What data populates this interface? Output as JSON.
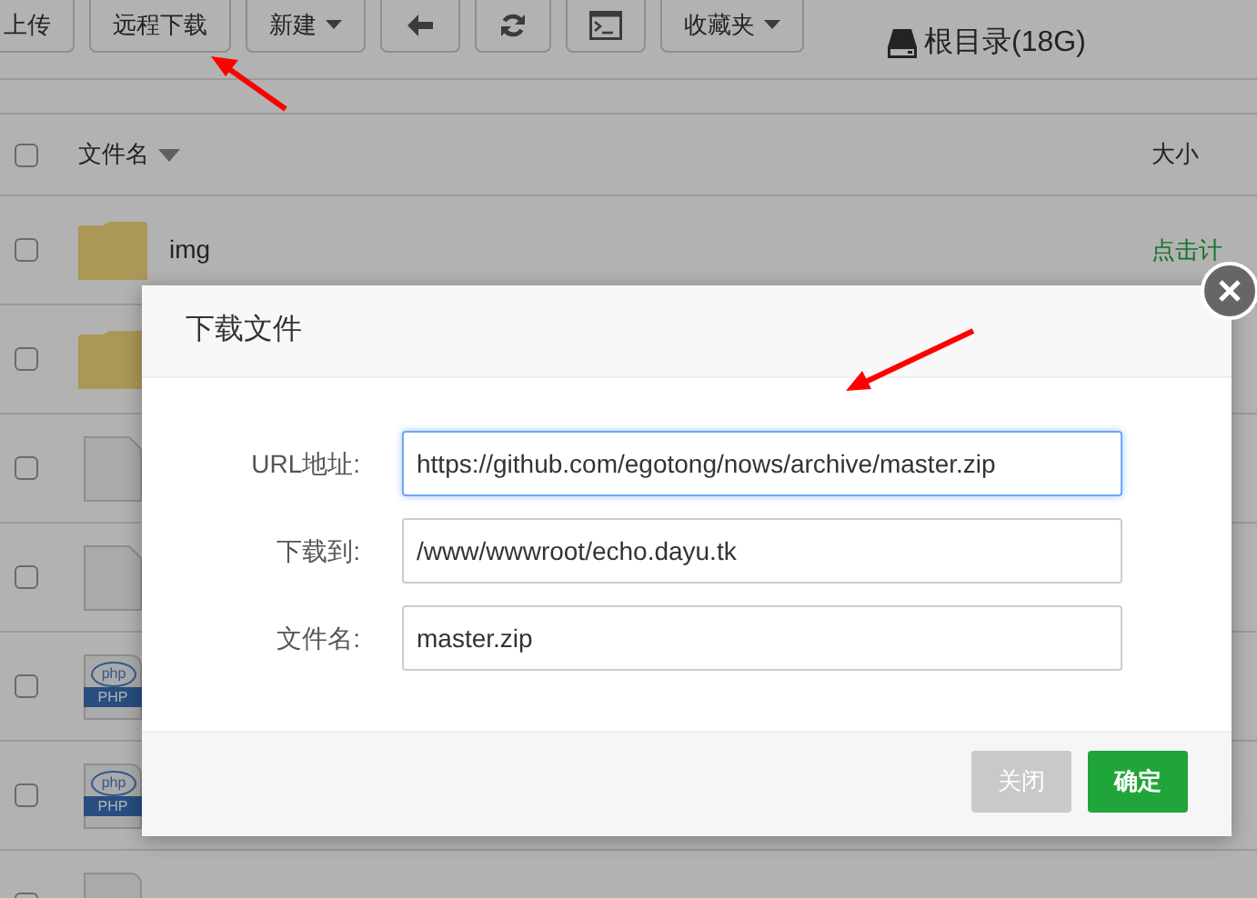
{
  "toolbar": {
    "buttons": [
      {
        "kind": "text",
        "label": "上传"
      },
      {
        "kind": "text",
        "label": "远程下载"
      },
      {
        "kind": "dropdown",
        "label": "新建"
      },
      {
        "kind": "back"
      },
      {
        "kind": "refresh"
      },
      {
        "kind": "terminal"
      },
      {
        "kind": "dropdown",
        "label": "收藏夹"
      }
    ],
    "disk": "根目录(18G)"
  },
  "table": {
    "header_checked": false,
    "columns": [
      "文件名",
      "大小"
    ],
    "rows": [
      {
        "kind": "folder",
        "name": "img",
        "size": "点击计",
        "checked": false
      },
      {
        "kind": "folder",
        "checked": false
      },
      {
        "kind": "file",
        "checked": false
      },
      {
        "kind": "file",
        "checked": false
      },
      {
        "kind": "php",
        "icon_text": "php",
        "badge": "PHP",
        "checked": false
      },
      {
        "kind": "php",
        "icon_text": "php",
        "badge": "PHP",
        "checked": false
      },
      {
        "kind": "php",
        "checked": false
      }
    ]
  },
  "dialog": {
    "title": "下载文件",
    "fields": [
      {
        "label": "URL地址:",
        "value": "https://github.com/egotong/nows/archive/master.zip",
        "focused": true
      },
      {
        "label": "下载到:",
        "value": "/www/wwwroot/echo.dayu.tk",
        "focused": false
      },
      {
        "label": "文件名:",
        "value": "master.zip",
        "focused": false
      }
    ],
    "buttons": [
      {
        "kind": "secondary",
        "label": "关闭"
      },
      {
        "kind": "primary",
        "label": "确定"
      }
    ]
  }
}
